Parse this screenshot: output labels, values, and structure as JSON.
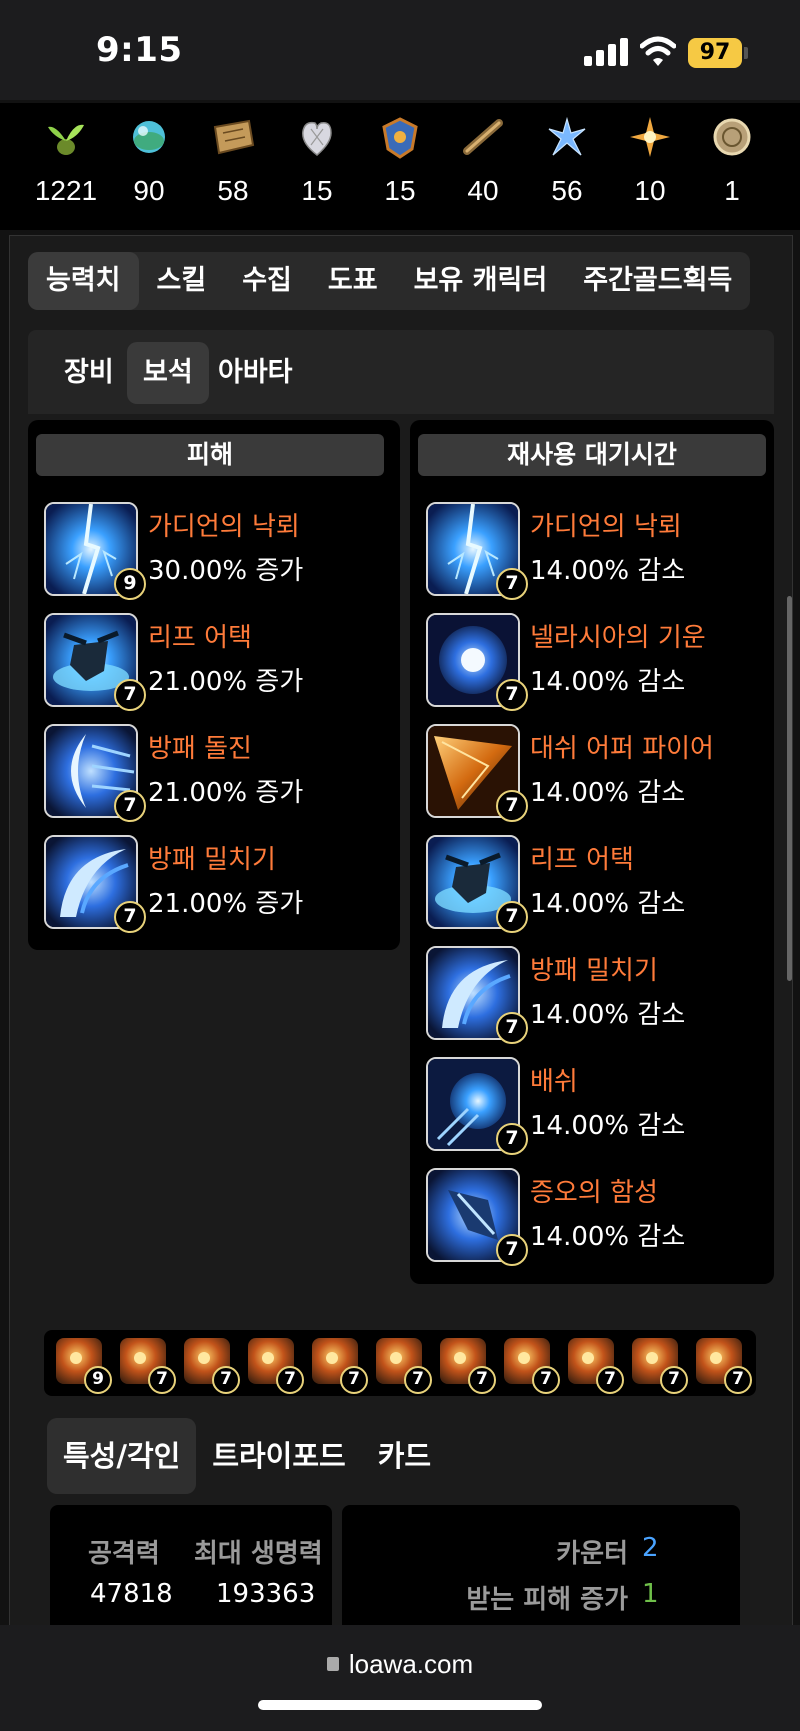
{
  "status": {
    "time": "9:15",
    "battery": "97"
  },
  "resources": [
    {
      "icon": "sprout-icon",
      "value": "1221"
    },
    {
      "icon": "orb-icon",
      "value": "90"
    },
    {
      "icon": "map-icon",
      "value": "58"
    },
    {
      "icon": "heart-icon",
      "value": "15"
    },
    {
      "icon": "crest-icon",
      "value": "15"
    },
    {
      "icon": "telescope-icon",
      "value": "40"
    },
    {
      "icon": "leaf-icon",
      "value": "56"
    },
    {
      "icon": "compass-star-icon",
      "value": "10"
    },
    {
      "icon": "coin-icon",
      "value": "1"
    }
  ],
  "tabs": [
    "능력치",
    "스킬",
    "수집",
    "도표",
    "보유 캐릭터",
    "주간골드획득"
  ],
  "subtabs": [
    "장비",
    "보석",
    "아바타"
  ],
  "damage": {
    "header": "피해",
    "gems": [
      {
        "name": "가디언의 낙뢰",
        "effect": "30.00% 증가",
        "level": "9"
      },
      {
        "name": "리프 어택",
        "effect": "21.00% 증가",
        "level": "7"
      },
      {
        "name": "방패 돌진",
        "effect": "21.00% 증가",
        "level": "7"
      },
      {
        "name": "방패 밀치기",
        "effect": "21.00% 증가",
        "level": "7"
      }
    ]
  },
  "cooldown": {
    "header": "재사용 대기시간",
    "gems": [
      {
        "name": "가디언의 낙뢰",
        "effect": "14.00% 감소",
        "level": "7"
      },
      {
        "name": "넬라시아의 기운",
        "effect": "14.00% 감소",
        "level": "7"
      },
      {
        "name": "대쉬 어퍼 파이어",
        "effect": "14.00% 감소",
        "level": "7"
      },
      {
        "name": "리프 어택",
        "effect": "14.00% 감소",
        "level": "7"
      },
      {
        "name": "방패 밀치기",
        "effect": "14.00% 감소",
        "level": "7"
      },
      {
        "name": "배쉬",
        "effect": "14.00% 감소",
        "level": "7"
      },
      {
        "name": "증오의 함성",
        "effect": "14.00% 감소",
        "level": "7"
      }
    ]
  },
  "mini_gems": [
    "9",
    "7",
    "7",
    "7",
    "7",
    "7",
    "7",
    "7",
    "7",
    "7",
    "7"
  ],
  "tabs2": [
    "특성/각인",
    "트라이포드",
    "카드"
  ],
  "stats": {
    "attack_label": "공격력",
    "attack_value": "47818",
    "hp_label": "최대 생명력",
    "hp_value": "193363"
  },
  "engravings": [
    {
      "label": "카운터",
      "value": "2",
      "color": "#4aa3ff"
    },
    {
      "label": "받는 피해 증가",
      "value": "1",
      "color": "#6fbf4a"
    }
  ],
  "browser": {
    "url": "loawa.com"
  }
}
